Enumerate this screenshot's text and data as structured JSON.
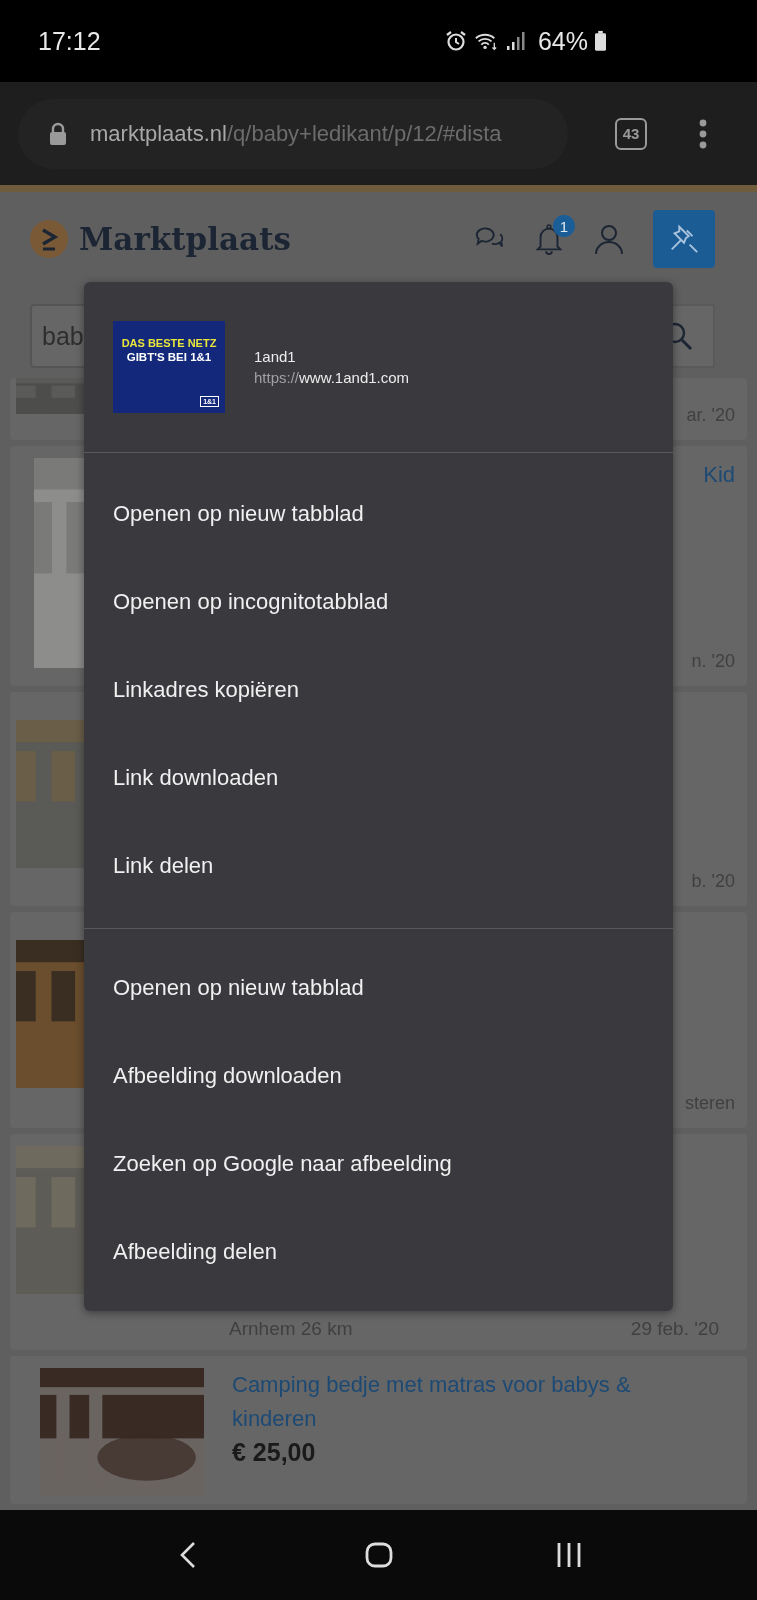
{
  "status_bar": {
    "time": "17:12",
    "battery": "64%"
  },
  "browser": {
    "url_host": "marktplaats.nl",
    "url_path": "/q/baby+ledikant/p/12/#dista",
    "tab_count": "43"
  },
  "header": {
    "logo": "Marktplaats",
    "notification_count": "1"
  },
  "search": {
    "value": "bab"
  },
  "listings": [
    {
      "date": "ar. '20"
    },
    {
      "title": "Kid",
      "date": "n. '20"
    },
    {
      "date": "b. '20"
    },
    {
      "date": "steren"
    },
    {
      "location": "Arnhem 26 km",
      "date": "29 feb. '20"
    },
    {
      "title": "Camping bedje met matras voor babys & kinderen",
      "price": "€ 25,00"
    }
  ],
  "context_menu": {
    "thumbnail": {
      "line_1": "DAS BESTE NETZ",
      "line_2": "GIBT'S BEI 1&1",
      "badge": "1&1"
    },
    "link_title": "1and1",
    "link_scheme": "https://",
    "link_host": "www.1and1.com",
    "sections": [
      {
        "items": [
          "Openen op nieuw tabblad",
          "Openen op incognitotabblad",
          "Linkadres kopiëren",
          "Link downloaden",
          "Link delen"
        ]
      },
      {
        "items": [
          "Openen op nieuw tabblad",
          "Afbeelding downloaden",
          "Zoeken op Google naar afbeelding",
          "Afbeelding delen"
        ]
      }
    ]
  }
}
